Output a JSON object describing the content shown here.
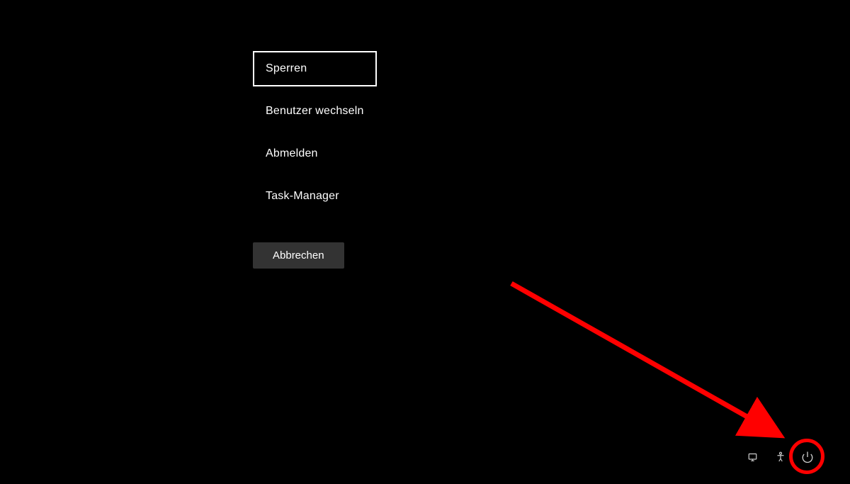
{
  "menu": {
    "items": [
      {
        "label": "Sperren",
        "selected": true
      },
      {
        "label": "Benutzer wechseln",
        "selected": false
      },
      {
        "label": "Abmelden",
        "selected": false
      },
      {
        "label": "Task-Manager",
        "selected": false
      }
    ],
    "cancel_label": "Abbrechen"
  },
  "tray": {
    "icons": [
      {
        "name": "network-icon"
      },
      {
        "name": "accessibility-icon"
      },
      {
        "name": "power-icon"
      }
    ]
  },
  "annotation": {
    "highlight_target": "power-icon"
  }
}
